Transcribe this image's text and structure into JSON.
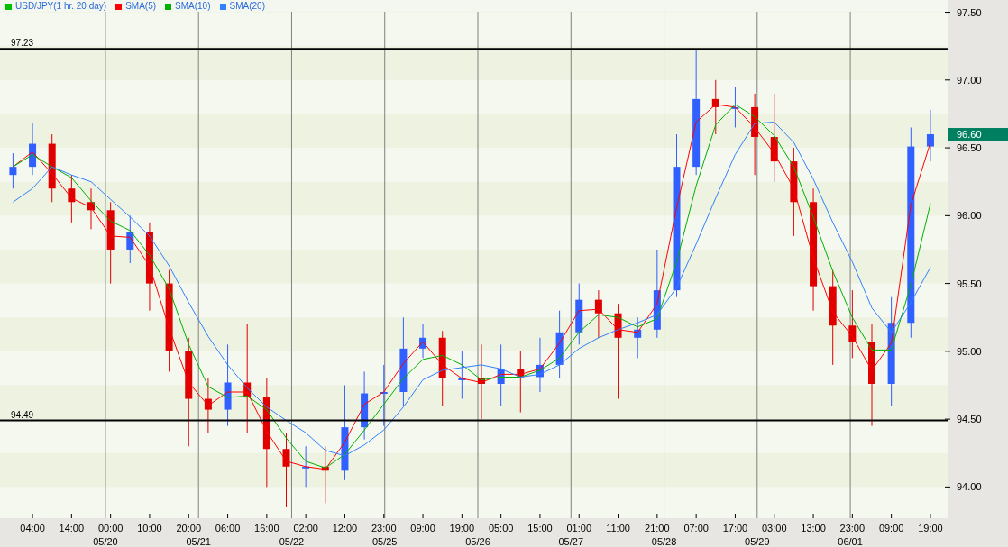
{
  "chart": {
    "legend_swatch": {
      "color": "#00c000"
    },
    "date_labels": [
      "05/20",
      "05/21",
      "05/22",
      "05/25",
      "05/26",
      "05/27",
      "05/28",
      "05/29",
      "06/01"
    ],
    "chart_data": {
      "type": "candlestick",
      "title": "USD/JPY(1 hr. 20 day)",
      "ylim": [
        93.77,
        97.59
      ],
      "categories": [
        null,
        "04:00",
        null,
        "14:00",
        null,
        "00:00",
        null,
        "10:00",
        null,
        "20:00",
        null,
        "06:00",
        null,
        "16:00",
        null,
        "02:00",
        null,
        "12:00",
        null,
        "23:00",
        null,
        "09:00",
        null,
        "19:00",
        null,
        "05:00",
        null,
        "15:00",
        null,
        "01:00",
        null,
        "11:00",
        null,
        "21:00",
        null,
        "07:00",
        null,
        "17:00",
        null,
        "03:00",
        null,
        "13:00",
        null,
        "23:00",
        null,
        "09:00",
        null,
        "19:00"
      ],
      "ohlc": [
        [
          96.3,
          96.46,
          96.2,
          96.36
        ],
        [
          96.36,
          96.68,
          96.3,
          96.53
        ],
        [
          96.53,
          96.6,
          96.1,
          96.2
        ],
        [
          96.2,
          96.3,
          95.95,
          96.1
        ],
        [
          96.1,
          96.2,
          95.9,
          96.04
        ],
        [
          96.04,
          96.1,
          95.5,
          95.75
        ],
        [
          95.75,
          96.0,
          95.65,
          95.88
        ],
        [
          95.88,
          95.95,
          95.3,
          95.5
        ],
        [
          95.5,
          95.6,
          94.85,
          95.0
        ],
        [
          95.0,
          95.1,
          94.3,
          94.65
        ],
        [
          94.65,
          94.8,
          94.4,
          94.57
        ],
        [
          94.57,
          95.05,
          94.45,
          94.77
        ],
        [
          94.77,
          95.2,
          94.4,
          94.66
        ],
        [
          94.66,
          94.8,
          94.0,
          94.28
        ],
        [
          94.28,
          94.4,
          93.85,
          94.15
        ],
        [
          94.15,
          94.3,
          94.0,
          94.15
        ],
        [
          94.15,
          94.3,
          93.88,
          94.12
        ],
        [
          94.12,
          94.75,
          94.05,
          94.44
        ],
        [
          94.44,
          94.85,
          94.35,
          94.69
        ],
        [
          94.69,
          94.9,
          94.45,
          94.7
        ],
        [
          94.7,
          95.25,
          94.6,
          95.02
        ],
        [
          95.02,
          95.2,
          94.95,
          95.1
        ],
        [
          95.1,
          95.15,
          94.6,
          94.8
        ],
        [
          94.8,
          95.0,
          94.65,
          94.8
        ],
        [
          94.8,
          95.05,
          94.5,
          94.76
        ],
        [
          94.76,
          95.05,
          94.6,
          94.87
        ],
        [
          94.87,
          95.0,
          94.55,
          94.81
        ],
        [
          94.81,
          95.1,
          94.7,
          94.9
        ],
        [
          94.9,
          95.3,
          94.8,
          95.14
        ],
        [
          95.14,
          95.5,
          95.05,
          95.38
        ],
        [
          95.38,
          95.45,
          95.1,
          95.28
        ],
        [
          95.28,
          95.35,
          94.65,
          95.1
        ],
        [
          95.1,
          95.25,
          94.95,
          95.16
        ],
        [
          95.16,
          95.75,
          95.1,
          95.45
        ],
        [
          95.45,
          96.6,
          95.4,
          96.36
        ],
        [
          96.36,
          97.22,
          96.3,
          96.86
        ],
        [
          96.86,
          97.0,
          96.6,
          96.8
        ],
        [
          96.8,
          96.95,
          96.65,
          96.8
        ],
        [
          96.8,
          96.9,
          96.3,
          96.58
        ],
        [
          96.58,
          96.9,
          96.25,
          96.4
        ],
        [
          96.4,
          96.5,
          95.85,
          96.1
        ],
        [
          96.1,
          96.2,
          95.3,
          95.48
        ],
        [
          95.48,
          95.6,
          94.9,
          95.19
        ],
        [
          95.19,
          95.45,
          94.95,
          95.07
        ],
        [
          95.07,
          95.2,
          94.45,
          94.76
        ],
        [
          94.76,
          95.4,
          94.6,
          95.21
        ],
        [
          95.21,
          96.65,
          95.1,
          96.51
        ],
        [
          96.51,
          96.78,
          96.4,
          96.6
        ]
      ],
      "grid": true,
      "series": [
        {
          "name": "SMA(5)",
          "type": "line",
          "color": "#ff0000",
          "values": [
            96.36,
            96.47,
            96.31,
            96.13,
            96.06,
            95.85,
            95.84,
            95.63,
            95.17,
            94.77,
            94.6,
            94.7,
            94.7,
            94.41,
            94.19,
            94.15,
            94.13,
            94.33,
            94.61,
            94.7,
            94.91,
            95.07,
            94.9,
            94.8,
            94.77,
            94.83,
            94.83,
            94.87,
            95.06,
            95.3,
            95.31,
            95.16,
            95.14,
            95.35,
            96.06,
            96.69,
            96.82,
            96.8,
            96.65,
            96.46,
            96.2,
            95.69,
            95.29,
            95.11,
            94.86,
            95.06,
            96.08,
            96.54
          ]
        },
        {
          "name": "SMA(10)",
          "type": "line",
          "color": "#00b000",
          "values": [
            96.36,
            96.45,
            96.36,
            96.28,
            96.11,
            95.96,
            95.89,
            95.71,
            95.46,
            95.05,
            94.74,
            94.66,
            94.67,
            94.57,
            94.36,
            94.19,
            94.14,
            94.24,
            94.42,
            94.61,
            94.8,
            94.94,
            94.97,
            94.9,
            94.79,
            94.81,
            94.81,
            94.86,
            94.95,
            95.14,
            95.27,
            95.25,
            95.18,
            95.24,
            95.66,
            96.22,
            96.67,
            96.82,
            96.73,
            96.59,
            96.36,
            95.99,
            95.59,
            95.25,
            95.01,
            95.01,
            95.49,
            96.09
          ]
        },
        {
          "name": "SMA(20)",
          "type": "line",
          "color": "#3080ff",
          "values": [
            96.1,
            96.2,
            96.36,
            96.3,
            96.25,
            96.12,
            95.99,
            95.85,
            95.63,
            95.36,
            95.11,
            94.9,
            94.73,
            94.59,
            94.49,
            94.4,
            94.27,
            94.23,
            94.31,
            94.42,
            94.59,
            94.79,
            94.86,
            94.88,
            94.9,
            94.87,
            94.81,
            94.83,
            94.9,
            95.02,
            95.1,
            95.16,
            95.21,
            95.27,
            95.47,
            95.79,
            96.13,
            96.45,
            96.68,
            96.69,
            96.54,
            96.27,
            95.95,
            95.66,
            95.32,
            95.14,
            95.36,
            95.62
          ]
        }
      ],
      "yticks": [
        {
          "value": 94,
          "label": "94.00"
        },
        {
          "value": 94.5,
          "label": "94.50"
        },
        {
          "value": 95,
          "label": "95.00"
        },
        {
          "value": 95.5,
          "label": "95.50"
        },
        {
          "value": 96,
          "label": "96.00"
        },
        {
          "value": 96.5,
          "label": "96.50"
        },
        {
          "value": 97,
          "label": "97.00"
        },
        {
          "value": 97.5,
          "label": "97.50"
        }
      ],
      "ref_lines": [
        {
          "axis": "y",
          "value": 97.23,
          "label": "97.23"
        },
        {
          "axis": "y",
          "value": 94.49,
          "label": "94.49"
        }
      ],
      "annotations": [
        "96.60"
      ]
    }
  }
}
